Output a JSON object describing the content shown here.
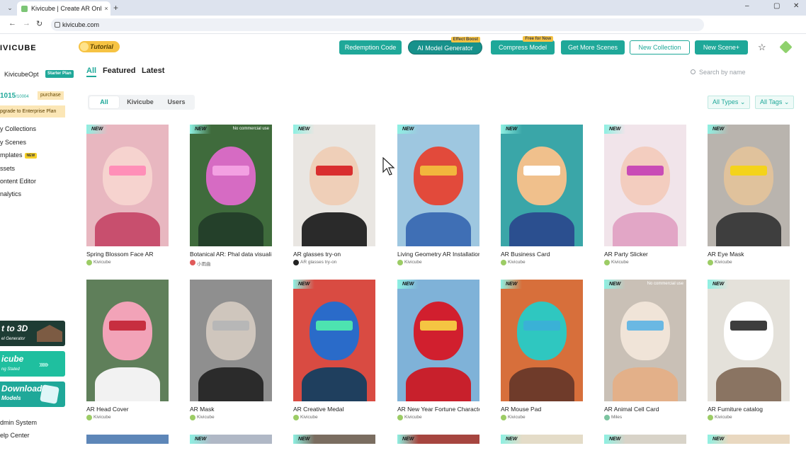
{
  "browser": {
    "tab_title": "Kivicube | Create AR Online ...",
    "tab_close": "×",
    "new_tab": "+",
    "url": "kivicube.com",
    "window_controls": [
      "–",
      "▢",
      "✕"
    ],
    "nav": [
      "←",
      "→",
      "↻"
    ],
    "tab_menu": "⌄"
  },
  "header": {
    "logo": "IVICUBE",
    "tutorial": "Tutorial",
    "buttons": {
      "redemption": "Redemption Code",
      "ai_model": "AI Model Generator",
      "ai_ribbon": "Effect Boost",
      "compress": "Compress Model",
      "compress_ribbon": "Free for Now",
      "more_scenes": "Get More Scenes",
      "new_collection": "New Collection",
      "new_scene": "New Scene+"
    },
    "icons": [
      "star-plus-icon",
      "cube-logo-icon"
    ]
  },
  "sidebar": {
    "user": "KivicubeOpt",
    "plan": "Starter Plan",
    "usage_value": "1015",
    "usage_total": "/10004",
    "purchase": "purchase",
    "upgrade": "pgrade to Enterprise Plan",
    "items": [
      {
        "label": "y Collections"
      },
      {
        "label": "y Scenes"
      },
      {
        "label": "mplates",
        "badge": "NEW"
      },
      {
        "label": "ssets"
      },
      {
        "label": "ontent Editor"
      },
      {
        "label": "nalytics"
      }
    ],
    "promos": [
      {
        "title": "t to 3D",
        "sub": "el Generator"
      },
      {
        "title": "icube",
        "sub": "ng Stated"
      },
      {
        "title": "Download",
        "sub": "Models"
      }
    ],
    "bottom_items": [
      {
        "label": "dmin System"
      },
      {
        "label": "elp Center"
      }
    ]
  },
  "main": {
    "tabs": [
      "All",
      "Featured",
      "Latest"
    ],
    "active_tab": "All",
    "search_placeholder": "Search by name",
    "source_filters": [
      "All",
      "Kivicube",
      "Users"
    ],
    "active_source": "All",
    "dropdowns": [
      "All Types ⌄",
      "All Tags ⌄"
    ]
  },
  "new_tag": "NEW",
  "no_commercial": "No commercial use",
  "cards": [
    {
      "title": "Spring Blossom Face AR",
      "author": "Kivicube",
      "new": true,
      "nocom": false,
      "bg": "#e8b7c0",
      "c1": "#f6d3cf",
      "c2": "#c84f6e",
      "c3": "#ff8fb8",
      "av": "#9ccc65"
    },
    {
      "title": "Botanical AR: Phal data visuali...",
      "author": "小雨曲",
      "new": true,
      "nocom": true,
      "bg": "#3f6b3c",
      "c1": "#d66bc3",
      "c2": "#24402a",
      "c3": "#f3a0e2",
      "av": "#e05a5a"
    },
    {
      "title": "AR glasses try-on",
      "author": "AR glasses try-on",
      "new": true,
      "nocom": false,
      "bg": "#e9e6e2",
      "c1": "#efcfb8",
      "c2": "#2a2a2a",
      "c3": "#d92e2e",
      "av": "#222222"
    },
    {
      "title": "Living Geometry AR Installation",
      "author": "Kivicube",
      "new": true,
      "nocom": false,
      "bg": "#9ec7e0",
      "c1": "#e24a3b",
      "c2": "#3f6fb5",
      "c3": "#f2b63d",
      "av": "#9ccc65"
    },
    {
      "title": "AR Business Card",
      "author": "Kivicube",
      "new": true,
      "nocom": false,
      "bg": "#3aa6a8",
      "c1": "#f0c08c",
      "c2": "#2b4f8f",
      "c3": "#ffffff",
      "av": "#9ccc65"
    },
    {
      "title": "AR Party Slicker",
      "author": "Kivicube",
      "new": true,
      "nocom": false,
      "bg": "#f1e4ea",
      "c1": "#f3cdbf",
      "c2": "#e2a6c6",
      "c3": "#c94cb6",
      "av": "#9ccc65"
    },
    {
      "title": "AR Eye Mask",
      "author": "Kivicube",
      "new": true,
      "nocom": false,
      "bg": "#b9b4ae",
      "c1": "#e0c29c",
      "c2": "#3e3e3e",
      "c3": "#f4d31b",
      "av": "#9ccc65"
    },
    {
      "title": "AR Head Cover",
      "author": "Kivicube",
      "new": false,
      "nocom": false,
      "bg": "#5f7f5a",
      "c1": "#f2a3b8",
      "c2": "#f2f2f2",
      "c3": "#c72e3f",
      "av": "#9ccc65"
    },
    {
      "title": "AR Mask",
      "author": "Kivicube",
      "new": false,
      "nocom": false,
      "bg": "#8f8f8f",
      "c1": "#cfc6bd",
      "c2": "#2b2b2b",
      "c3": "#b7b7b7",
      "av": "#9ccc65"
    },
    {
      "title": "AR Creative Medal",
      "author": "Kivicube",
      "new": true,
      "nocom": false,
      "bg": "#d94b42",
      "c1": "#2a6bc9",
      "c2": "#1f3f5e",
      "c3": "#4de3b0",
      "av": "#9ccc65"
    },
    {
      "title": "AR New Year Fortune Character",
      "author": "Kivicube",
      "new": true,
      "nocom": false,
      "bg": "#7fb2d8",
      "c1": "#d11f2e",
      "c2": "#c8202c",
      "c3": "#f5c542",
      "av": "#9ccc65"
    },
    {
      "title": "AR Mouse Pad",
      "author": "Kivicube",
      "new": true,
      "nocom": false,
      "bg": "#d76f3b",
      "c1": "#2fc7c0",
      "c2": "#6f3b2a",
      "c3": "#3ab1d6",
      "av": "#9ccc65"
    },
    {
      "title": "AR Animal Cell Card",
      "author": "Miles",
      "new": true,
      "nocom": true,
      "bg": "#c9c0b6",
      "c1": "#f0e4d8",
      "c2": "#e3b089",
      "c3": "#6ab8e3",
      "av": "#7cc4a0"
    },
    {
      "title": "AR Furniture catalog",
      "author": "Kivicube",
      "new": true,
      "nocom": false,
      "bg": "#e4e1da",
      "c1": "#ffffff",
      "c2": "#8a7462",
      "c3": "#3d3d3d",
      "av": "#9ccc65"
    }
  ],
  "partial_cards": [
    {
      "new": false,
      "bg": "#5d86b8"
    },
    {
      "new": true,
      "bg": "#b0b8c6"
    },
    {
      "new": true,
      "bg": "#7a6d60"
    },
    {
      "new": true,
      "bg": "#a6453f"
    },
    {
      "new": true,
      "bg": "#e4dcc8"
    },
    {
      "new": true,
      "bg": "#d8d3c8"
    },
    {
      "new": true,
      "bg": "#e9d8c0"
    }
  ]
}
